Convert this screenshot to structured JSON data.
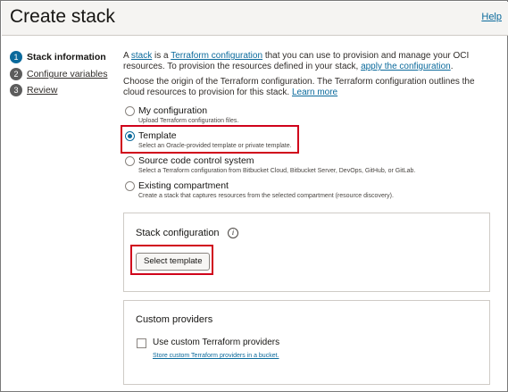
{
  "header": {
    "title": "Create stack",
    "help_label": "Help"
  },
  "steps": [
    {
      "number": "1",
      "label": "Stack information",
      "state": "active"
    },
    {
      "number": "2",
      "label": "Configure variables",
      "state": "link"
    },
    {
      "number": "3",
      "label": "Review",
      "state": "link"
    }
  ],
  "intro": {
    "a_prefix": "A",
    "stack_link": "stack",
    "is_a": "is a",
    "terraform_link": "Terraform configuration",
    "rest1": "that you can use to provision and manage your OCI resources. To provision the resources defined in your stack,",
    "apply_link": "apply the configuration",
    "end": "."
  },
  "origin": {
    "text": "Choose the origin of the Terraform configuration. The Terraform configuration outlines the cloud resources to provision for this stack.",
    "learn_more": "Learn more"
  },
  "options": [
    {
      "label": "My configuration",
      "desc": "Upload Terraform configuration files.",
      "checked": false
    },
    {
      "label": "Template",
      "desc": "Select an Oracle-provided template or private template.",
      "checked": true
    },
    {
      "label": "Source code control system",
      "desc": "Select a Terraform configuration from Bitbucket Cloud, Bitbucket Server, DevOps, GitHub, or GitLab.",
      "checked": false
    },
    {
      "label": "Existing compartment",
      "desc": "Create a stack that captures resources from the selected compartment (resource discovery).",
      "checked": false
    }
  ],
  "stack_config": {
    "title": "Stack configuration",
    "info_glyph": "i",
    "button_label": "Select template"
  },
  "custom_providers": {
    "title": "Custom providers",
    "checkbox_label": "Use custom Terraform providers",
    "link": "Store custom Terraform providers in a bucket."
  },
  "colors": {
    "accent": "#0b6a9c",
    "highlight": "#d0021b"
  }
}
